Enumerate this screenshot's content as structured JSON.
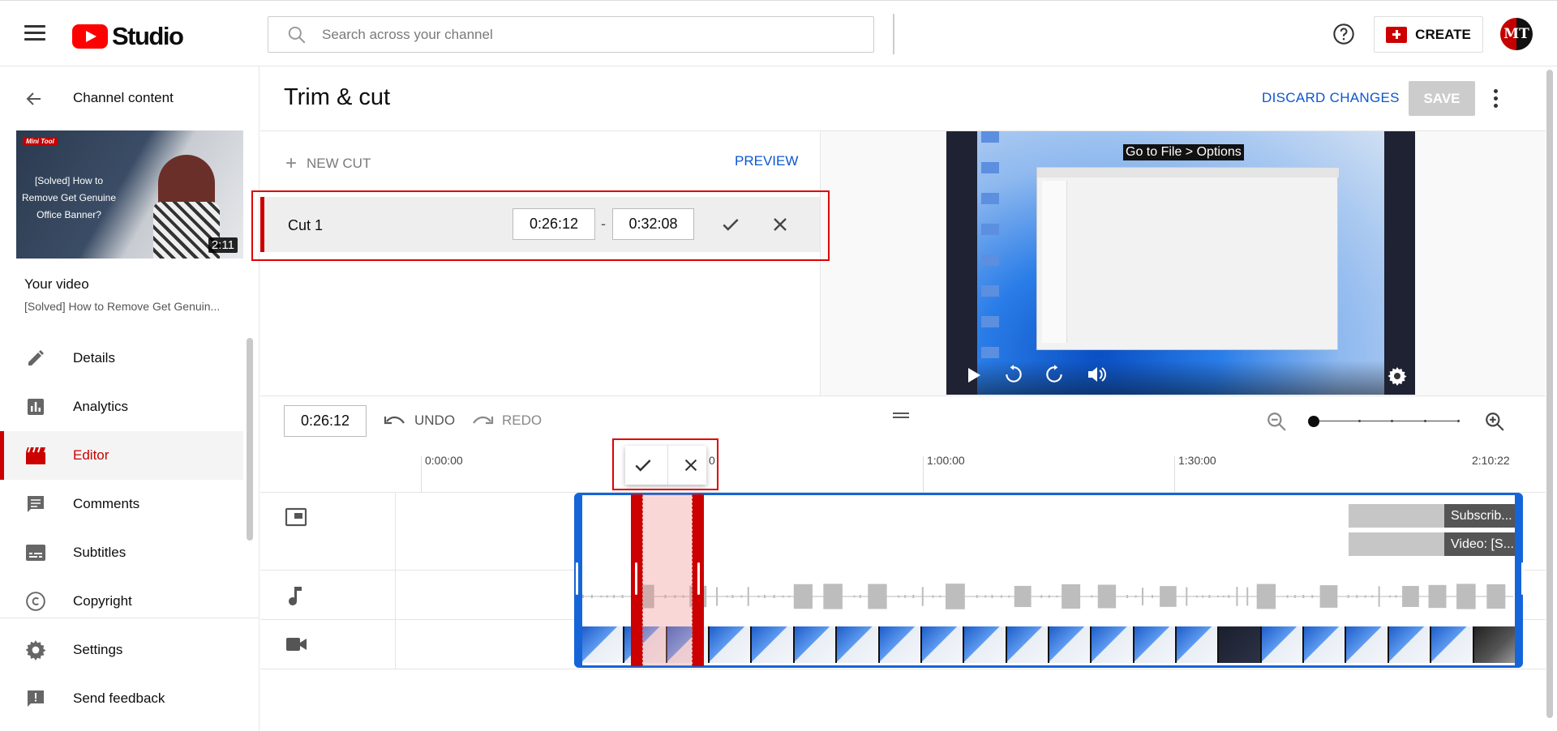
{
  "header": {
    "logo_text": "Studio",
    "search_placeholder": "Search across your channel",
    "create_label": "CREATE",
    "avatar_initials": "MT"
  },
  "sidebar": {
    "back_title": "Channel content",
    "thumbnail": {
      "badge": "Mini Tool",
      "title": "[Solved] How to Remove Get Genuine Office Banner?",
      "duration": "2:11"
    },
    "your_video_label": "Your video",
    "video_name": "[Solved] How to Remove Get Genuin...",
    "items": [
      {
        "label": "Details",
        "icon": "pencil-icon"
      },
      {
        "label": "Analytics",
        "icon": "bar-chart-icon"
      },
      {
        "label": "Editor",
        "icon": "clapperboard-icon",
        "active": true
      },
      {
        "label": "Comments",
        "icon": "comment-icon"
      },
      {
        "label": "Subtitles",
        "icon": "subtitles-icon"
      },
      {
        "label": "Copyright",
        "icon": "copyright-icon"
      }
    ],
    "bottom_items": [
      {
        "label": "Settings",
        "icon": "gear-icon"
      },
      {
        "label": "Send feedback",
        "icon": "feedback-icon"
      }
    ]
  },
  "editor": {
    "title": "Trim & cut",
    "discard_label": "DISCARD CHANGES",
    "save_label": "SAVE",
    "new_cut_label": "NEW CUT",
    "preview_label": "PREVIEW",
    "cut": {
      "label": "Cut 1",
      "start": "0:26:12",
      "separator": "-",
      "end": "0:32:08"
    },
    "player": {
      "caption": "Go to File > Options"
    }
  },
  "timeline": {
    "current_time": "0:26:12",
    "undo_label": "UNDO",
    "redo_label": "REDO",
    "ruler": [
      "0:00:00",
      "1:00:00",
      "1:30:00",
      "2:10:22"
    ],
    "ruler_partial": "0",
    "elements": [
      {
        "label": "Subscrib..."
      },
      {
        "label": "Video: [S..."
      }
    ]
  },
  "colors": {
    "accent": "#cc0000",
    "link": "#0b57d0",
    "clip_border": "#1565d8",
    "highlight": "#e00000"
  }
}
